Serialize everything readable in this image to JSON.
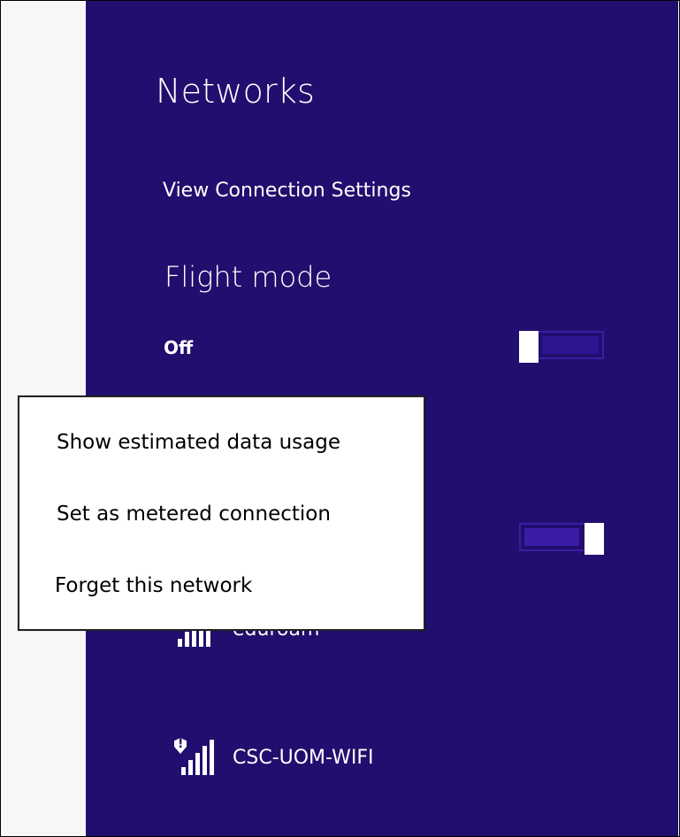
{
  "networks_panel": {
    "title": "Networks",
    "view_settings_label": "View Connection Settings",
    "flight_mode": {
      "title": "Flight mode",
      "state": "Off"
    },
    "networks": [
      {
        "name": "eduroam",
        "icon": "wifi-signal-icon"
      },
      {
        "name": "CSC-UOM-WIFI",
        "icon": "wifi-signal-shield-icon"
      }
    ],
    "colors": {
      "panel_background": "#220e6e",
      "accent": "#3b1ca6"
    }
  },
  "context_menu": {
    "items": [
      "Show estimated data usage",
      "Set as metered connection",
      "Forget this network"
    ]
  }
}
